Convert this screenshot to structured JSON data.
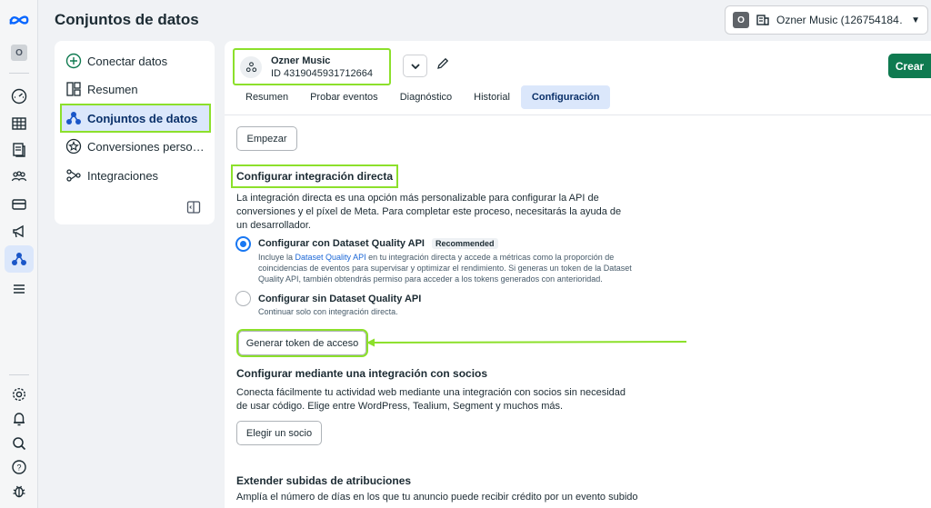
{
  "header": {
    "title": "Conjuntos de datos",
    "account_initial": "O",
    "account_label": "Ozner Music (126754184…"
  },
  "rail": {
    "avatar_initial": "O"
  },
  "nav": {
    "items": [
      {
        "label": "Conectar datos"
      },
      {
        "label": "Resumen"
      },
      {
        "label": "Conjuntos de datos"
      },
      {
        "label": "Conversiones perso…"
      },
      {
        "label": "Integraciones"
      }
    ]
  },
  "dataset": {
    "name": "Ozner Music",
    "id": "ID 4319045931712664",
    "create_label": "Crear"
  },
  "tabs": [
    "Resumen",
    "Probar eventos",
    "Diagnóstico",
    "Historial",
    "Configuración"
  ],
  "content": {
    "start_button": "Empezar",
    "direct_title": "Configurar integración directa",
    "direct_desc": "La integración directa es una opción más personalizable para configurar la API de conversiones y el píxel de Meta. Para completar este proceso, necesitarás la ayuda de un desarrollador.",
    "opt1_title": "Configurar con Dataset Quality API",
    "opt1_badge": "Recommended",
    "opt1_desc_pre": "Incluye la ",
    "opt1_link": "Dataset Quality API",
    "opt1_desc_post": " en tu integración directa y accede a métricas como la proporción de coincidencias de eventos para supervisar y optimizar el rendimiento. Si generas un token de la Dataset Quality API, también obtendrás permiso para acceder a los tokens generados con anterioridad.",
    "opt2_title": "Configurar sin Dataset Quality API",
    "opt2_desc": "Continuar solo con integración directa.",
    "token_button": "Generar token de acceso",
    "partner_title": "Configurar mediante una integración con socios",
    "partner_desc": "Conecta fácilmente tu actividad web mediante una integración con socios sin necesidad de usar código. Elige entre WordPress, Tealium, Segment y muchos más.",
    "partner_button": "Elegir un socio",
    "extend_title": "Extender subidas de atribuciones",
    "extend_desc": "Amplía el número de días en los que tu anuncio puede recibir crédito por un evento subido"
  }
}
